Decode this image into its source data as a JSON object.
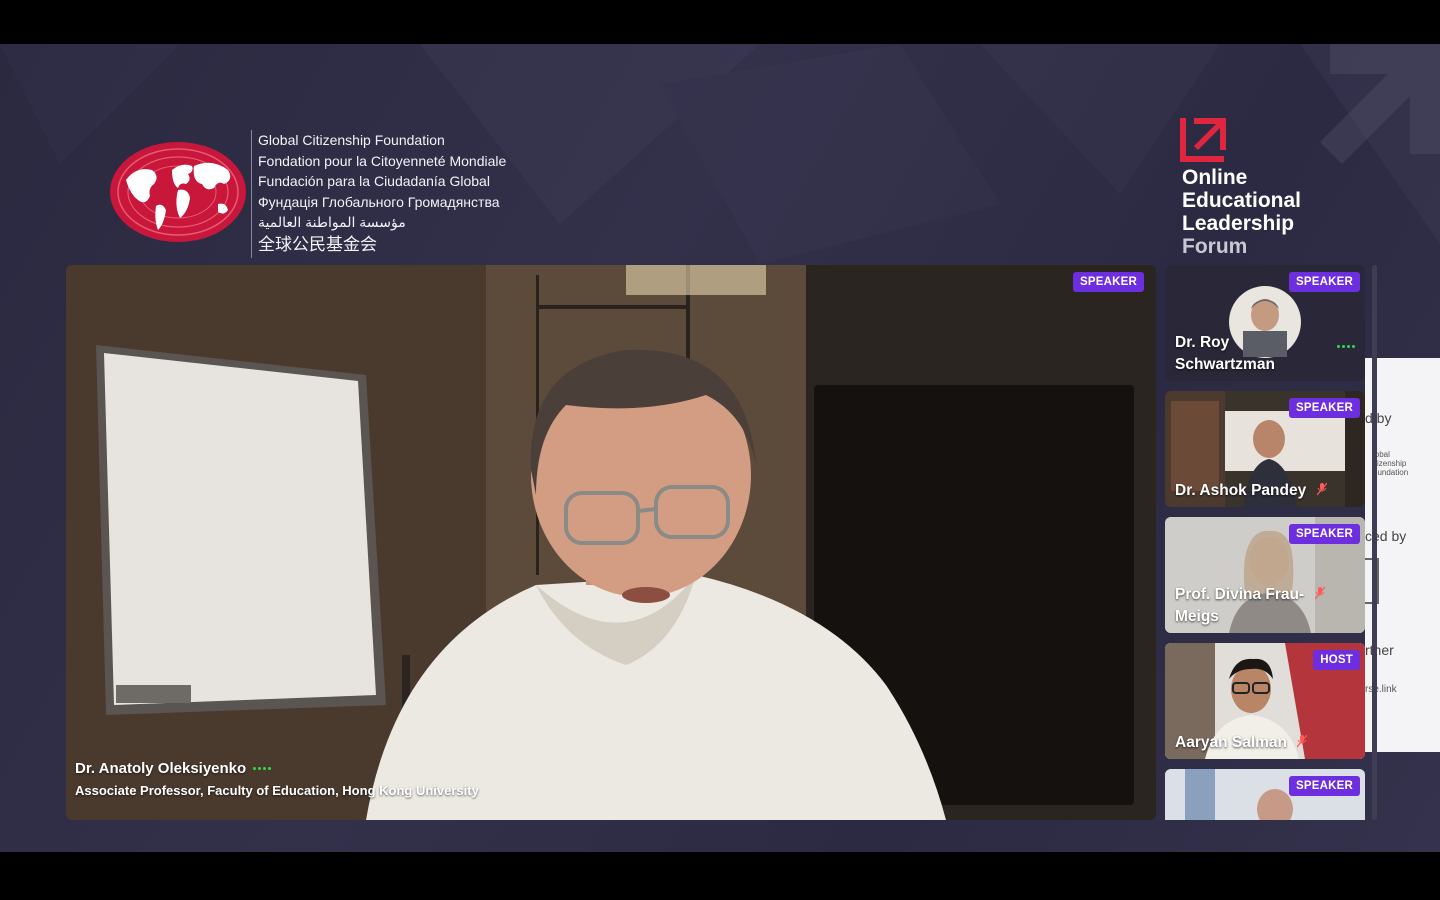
{
  "gcf": {
    "names": [
      "Global Citizenship Foundation",
      "Fondation pour la Citoyenneté Mondiale",
      "Fundación para la Ciudadanía Global",
      "Фундація Глобального Громадянства",
      "مؤسسة المواطنة العالمية",
      "全球公民基金会"
    ],
    "logo_color": "#c8173a"
  },
  "forum": {
    "line1": "Online",
    "line2": "Educational",
    "line3": "Leadership",
    "line4": "Forum",
    "accent": "#e0253f"
  },
  "main_speaker": {
    "badge": "SPEAKER",
    "name": "Dr. Anatoly Oleksiyenko",
    "subtitle": "Associate Professor, Faculty of Education, Hong Kong University"
  },
  "participants": [
    {
      "badge": "SPEAKER",
      "name_line1": "Dr. Roy",
      "name_line2": "Schwartzman",
      "muted": false
    },
    {
      "badge": "SPEAKER",
      "name_line1": "Dr. Ashok Pandey",
      "name_line2": "",
      "muted": true
    },
    {
      "badge": "SPEAKER",
      "name_line1": "Prof. Divina Frau-",
      "name_line2": "Meigs",
      "muted": true
    },
    {
      "badge": "HOST",
      "name_line1": "Aaryan Salman",
      "name_line2": "",
      "muted": true
    },
    {
      "badge": "SPEAKER",
      "name_line1": "",
      "name_line2": "",
      "muted": false
    }
  ],
  "sponsor_panel": {
    "label1": "d by",
    "label2": "ced by",
    "label3": "rtner",
    "label4": "rse.link",
    "logo_text_1": "lobal",
    "logo_text_2": "itizenship",
    "logo_text_3": "oundation"
  },
  "colors": {
    "badge_bg": "#6d2ee0",
    "stage_bg": "#2e2c44",
    "audio_active": "#32d74b"
  }
}
